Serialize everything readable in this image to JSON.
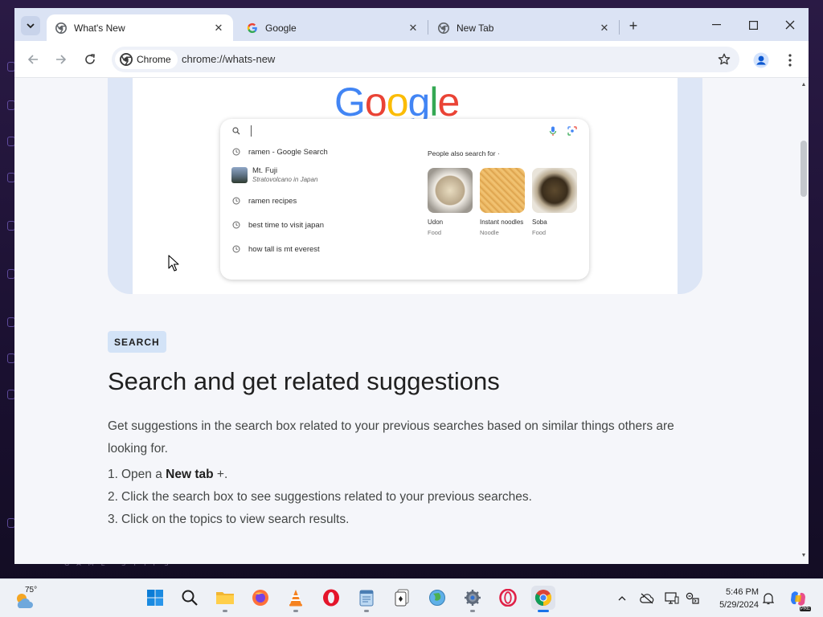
{
  "browser": {
    "tabs": [
      {
        "title": "What's New",
        "active": true
      },
      {
        "title": "Google",
        "active": false
      },
      {
        "title": "New Tab",
        "active": false
      }
    ],
    "new_tab_symbol": "+",
    "site_chip": "Chrome",
    "url": "chrome://whats-new"
  },
  "mockup": {
    "logo_letters": [
      {
        "ch": "G",
        "color": "#4285F4"
      },
      {
        "ch": "o",
        "color": "#EA4335"
      },
      {
        "ch": "o",
        "color": "#FBBC05"
      },
      {
        "ch": "g",
        "color": "#4285F4"
      },
      {
        "ch": "l",
        "color": "#34A853"
      },
      {
        "ch": "e",
        "color": "#EA4335"
      }
    ],
    "suggestions": [
      {
        "text": "ramen - Google Search",
        "icon": "history-icon"
      },
      {
        "text": "Mt. Fuji",
        "sub": "Stratovolcano in Japan",
        "icon": "thumbnail"
      },
      {
        "text": "ramen recipes",
        "icon": "history-icon"
      },
      {
        "text": "best time to visit japan",
        "icon": "history-icon"
      },
      {
        "text": "how tall is mt everest",
        "icon": "history-icon"
      }
    ],
    "people_also_search_title": "People also search for",
    "people_also_search": [
      {
        "name": "Udon",
        "category": "Food"
      },
      {
        "name": "Instant noodles",
        "category": "Noodle"
      },
      {
        "name": "Soba",
        "category": "Food"
      }
    ]
  },
  "article": {
    "badge": "SEARCH",
    "headline": "Search and get related suggestions",
    "description": "Get suggestions in the search box related to your previous searches based on similar things others are looking for.",
    "steps": [
      {
        "num": "1.",
        "pre": "Open a ",
        "bold": "New tab",
        "post": " +."
      },
      {
        "num": "2.",
        "pre": "Click the search box to see suggestions related to your previous searches.",
        "bold": "",
        "post": ""
      },
      {
        "num": "3.",
        "pre": "Click on the topics to view search results.",
        "bold": "",
        "post": ""
      }
    ]
  },
  "desktop": {
    "watermark": "GAME STIPS"
  },
  "taskbar": {
    "weather_temp": "75°",
    "time": "5:46 PM",
    "date": "5/29/2024",
    "apps": [
      "start",
      "search",
      "file-explorer",
      "firefox",
      "vlc",
      "opera",
      "notepad",
      "solitaire",
      "network-globe",
      "settings",
      "opera-gx",
      "chrome"
    ],
    "copilot_badge": "PRE"
  },
  "colors": {
    "accent": "#1a73e8",
    "tabstrip": "#dbe3f4",
    "badge_bg": "#d3e3f7"
  }
}
